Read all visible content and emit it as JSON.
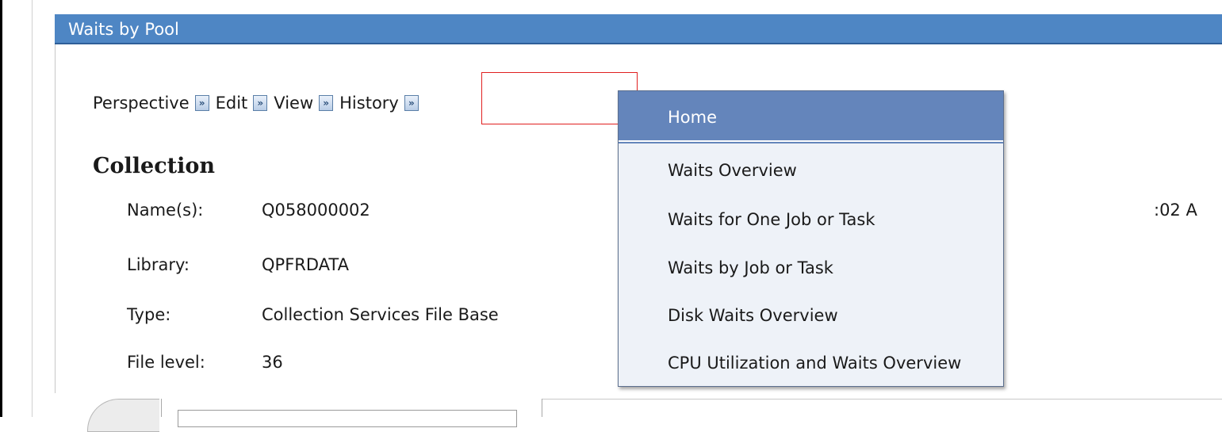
{
  "panel": {
    "title": "Waits by Pool"
  },
  "toolbar": {
    "perspective": "Perspective",
    "edit": "Edit",
    "view": "View",
    "history": "History",
    "arrow_glyph": "»"
  },
  "collection": {
    "title": "Collection",
    "fields": [
      {
        "label": "Name(s):",
        "value": "Q058000002"
      },
      {
        "label": "Library:",
        "value": "QPFRDATA"
      },
      {
        "label": "Type:",
        "value": "Collection Services File Base"
      },
      {
        "label": "File level:",
        "value": "36"
      }
    ],
    "partial_time": ":02 A"
  },
  "history_menu": {
    "header": "Home",
    "items": [
      "Waits Overview",
      "Waits for One Job or Task",
      "Waits by Job or Task",
      "Disk Waits Overview",
      "CPU Utilization and Waits Overview"
    ]
  },
  "colors": {
    "title_bar": "#4e86c4",
    "menu_header": "#6485bb",
    "menu_bg": "#eef2f8",
    "highlight": "#e02020"
  }
}
